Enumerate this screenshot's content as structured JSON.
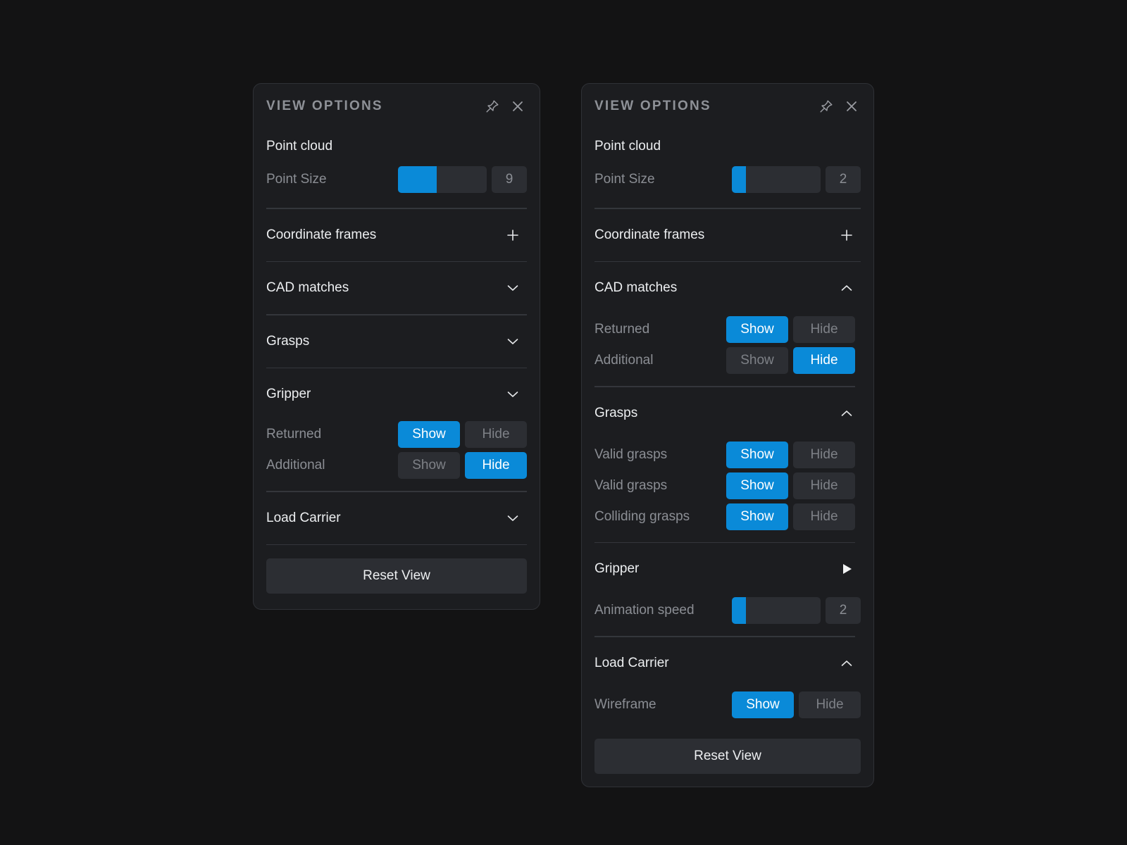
{
  "accent_color": "#0a8ad8",
  "panels": [
    {
      "title": "VIEW OPTIONS",
      "point_cloud": {
        "title": "Point cloud",
        "point_size_label": "Point Size",
        "point_size_value": "9",
        "point_size_fraction": 0.44
      },
      "coordinate_frames": {
        "title": "Coordinate frames",
        "icon": "plus-icon"
      },
      "cad_matches": {
        "title": "CAD matches",
        "icon": "chevron-down-icon"
      },
      "grasps": {
        "title": "Grasps",
        "icon": "chevron-down-icon"
      },
      "gripper": {
        "title": "Gripper",
        "icon": "chevron-down-icon",
        "rows": [
          {
            "label": "Returned",
            "show": "Show",
            "hide": "Hide",
            "selected": "show"
          },
          {
            "label": "Additional",
            "show": "Show",
            "hide": "Hide",
            "selected": "hide"
          }
        ]
      },
      "load_carrier": {
        "title": "Load Carrier",
        "icon": "chevron-down-icon"
      },
      "reset_label": "Reset View"
    },
    {
      "title": "VIEW OPTIONS",
      "point_cloud": {
        "title": "Point cloud",
        "point_size_label": "Point Size",
        "point_size_value": "2",
        "point_size_fraction": 0.16
      },
      "coordinate_frames": {
        "title": "Coordinate frames",
        "icon": "plus-icon"
      },
      "cad_matches": {
        "title": "CAD matches",
        "icon": "chevron-up-icon",
        "rows": [
          {
            "label": "Returned",
            "show": "Show",
            "hide": "Hide",
            "selected": "show"
          },
          {
            "label": "Additional",
            "show": "Show",
            "hide": "Hide",
            "selected": "hide"
          }
        ]
      },
      "grasps": {
        "title": "Grasps",
        "icon": "chevron-up-icon",
        "rows": [
          {
            "label": "Valid grasps",
            "show": "Show",
            "hide": "Hide",
            "selected": "show"
          },
          {
            "label": "Valid grasps",
            "show": "Show",
            "hide": "Hide",
            "selected": "show"
          },
          {
            "label": "Colliding grasps",
            "show": "Show",
            "hide": "Hide",
            "selected": "show"
          }
        ]
      },
      "gripper": {
        "title": "Gripper",
        "icon": "play-icon",
        "animation_speed_label": "Animation speed",
        "animation_speed_value": "2",
        "animation_speed_fraction": 0.16
      },
      "load_carrier": {
        "title": "Load Carrier",
        "icon": "chevron-up-icon",
        "rows": [
          {
            "label": "Wireframe",
            "show": "Show",
            "hide": "Hide",
            "selected": "show"
          }
        ]
      },
      "reset_label": "Reset View"
    }
  ]
}
